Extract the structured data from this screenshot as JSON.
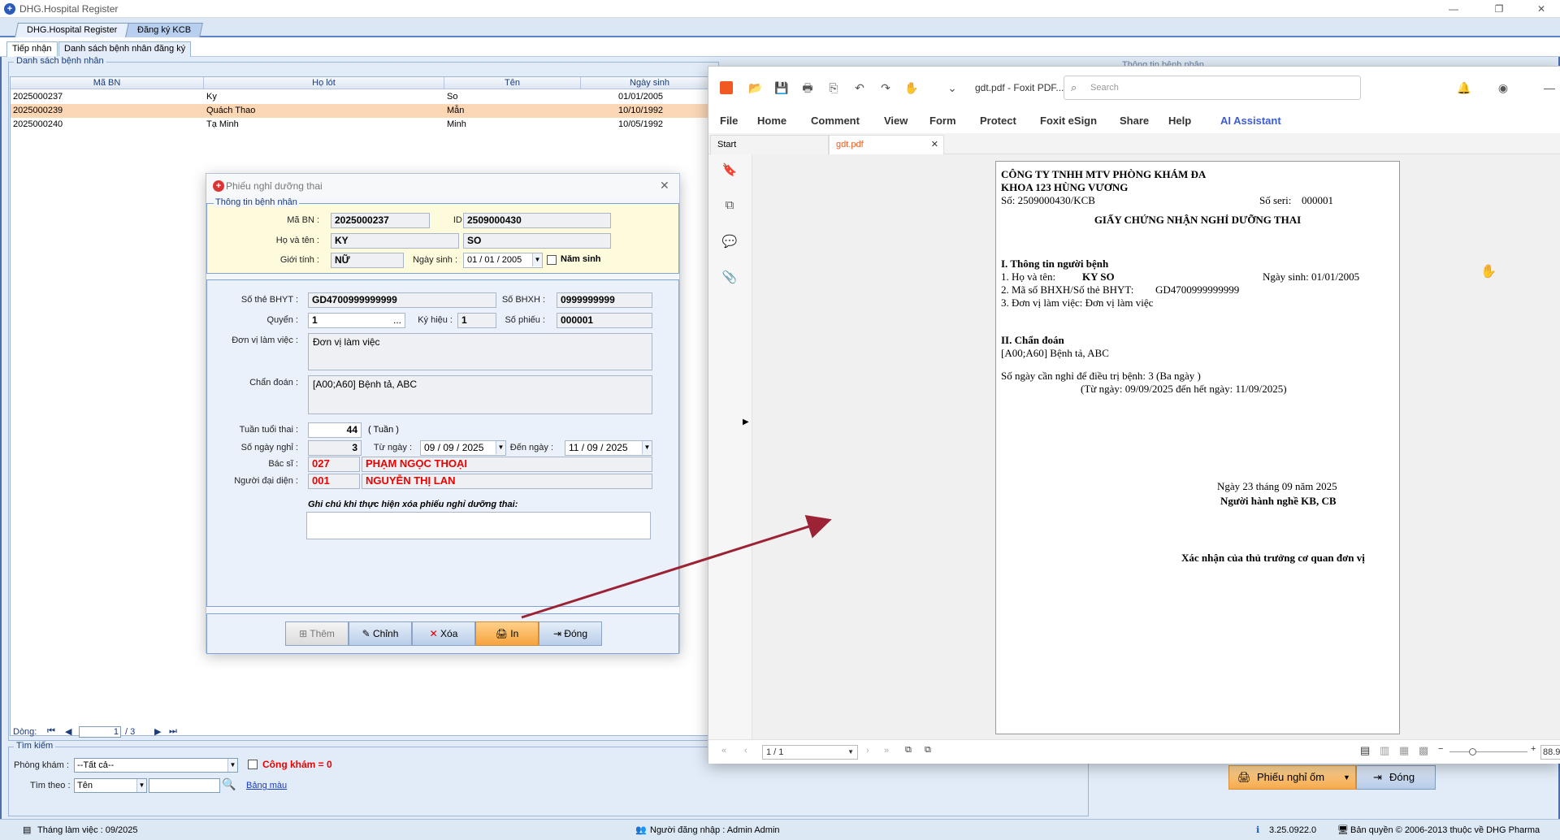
{
  "app": {
    "title": "DHG.Hospital Register",
    "main_tabs": [
      "DHG.Hospital Register",
      "Đăng ký KCB"
    ],
    "sub_tabs": [
      "Tiếp nhận",
      "Danh sách bệnh nhân đăng ký"
    ],
    "patient_group_title": "Danh sách bệnh nhân",
    "partial_group_title": "Thông tin bệnh nhân",
    "table_headers": [
      "Mã BN",
      "Họ lót",
      "Tên",
      "Ngày sinh"
    ],
    "rows": [
      {
        "ma_bn": "2025000237",
        "ho_lot": "Ky",
        "ten": "So",
        "ngay_sinh": "01/01/2005"
      },
      {
        "ma_bn": "2025000239",
        "ho_lot": "Quách Thao",
        "ten": "Mẫn",
        "ngay_sinh": "10/10/1992"
      },
      {
        "ma_bn": "2025000240",
        "ho_lot": "Tạ Minh",
        "ten": "Minh",
        "ngay_sinh": "10/05/1992"
      }
    ],
    "pager": {
      "label": "Dòng:",
      "current": "1",
      "total": "/ 3"
    },
    "search": {
      "group_title": "Tìm kiếm",
      "phong_kham_label": "Phòng khám :",
      "phong_kham_value": "--Tất cả--",
      "cong_kham_label": "Công khám = 0",
      "tim_theo_label": "Tìm theo :",
      "tim_theo_value": "Tên",
      "bang_mau": "Bảng màu"
    },
    "buttons": {
      "phieu_nghi_om": "Phiếu nghỉ ốm",
      "dong": "Đóng"
    },
    "status": {
      "thang_lam_viec": "Tháng làm việc : 09/2025",
      "nguoi_dang_nhap": "Người đăng nhập : Admin Admin",
      "version": "3.25.0922.0",
      "ban_quyen": "Bản quyền © 2006-2013 thuộc về DHG Pharma"
    }
  },
  "dialog": {
    "title": "Phiếu nghỉ dưỡng thai",
    "info_group_title": "Thông tin bệnh nhân",
    "ma_bn_label": "Mã BN :",
    "ma_bn": "2025000237",
    "id_label": "ID :",
    "id": "2509000430",
    "ho_ten_label": "Họ và tên :",
    "ho": "KY",
    "ten": "SO",
    "gioi_tinh_label": "Giới tính :",
    "gioi_tinh": "NỮ",
    "ngay_sinh_label": "Ngày sinh :",
    "ngay_sinh": "01 / 01 / 2005",
    "nam_sinh_label": "Năm sinh",
    "so_the_bhyt_label": "Số thẻ BHYT :",
    "so_the_bhyt": "GD4700999999999",
    "so_bhxh_label": "Số BHXH :",
    "so_bhxh": "0999999999",
    "quyen_label": "Quyển :",
    "quyen": "1",
    "ky_hieu_label": "Ký hiệu :",
    "ky_hieu": "1",
    "so_phieu_label": "Số phiếu :",
    "so_phieu": "000001",
    "don_vi_label": "Đơn vị làm việc :",
    "don_vi": "Đơn vị làm việc",
    "chan_doan_label": "Chẩn đoán :",
    "chan_doan": "[A00;A60] Bệnh tả, ABC",
    "tuan_tuoi_label": "Tuần tuổi thai :",
    "tuan_tuoi": "44",
    "tuan_unit": "( Tuần )",
    "so_ngay_label": "Số ngày nghỉ :",
    "so_ngay": "3",
    "tu_ngay_label": "Từ ngày :",
    "tu_ngay": "09 / 09 / 2025",
    "den_ngay_label": "Đến ngày :",
    "den_ngay": "11 / 09 / 2025",
    "bac_si_label": "Bác sĩ :",
    "bac_si_ma": "027",
    "bac_si_ten": "PHẠM NGỌC THOẠI",
    "nguoi_dai_dien_label": "Người đại diện :",
    "ndd_ma": "001",
    "ndd_ten": "NGUYỄN THỊ LAN",
    "ghi_chu_label": "Ghi chú khi thực hiện xóa phiếu nghỉ dưỡng thai:",
    "buttons": {
      "them": "Thêm",
      "chinh": "Chỉnh",
      "xoa": "Xóa",
      "in": "In",
      "dong": "Đóng"
    }
  },
  "foxit": {
    "doc_title": "gdt.pdf - Foxit PDF...",
    "search_placeholder": "Search",
    "menu": [
      "File",
      "Home",
      "Comment",
      "View",
      "Form",
      "Protect",
      "Foxit eSign",
      "Share",
      "Help",
      "AI Assistant"
    ],
    "tabs": [
      "Start",
      "gdt.pdf"
    ],
    "page_indicator": "1 / 1",
    "zoom": "88.9",
    "page": {
      "company1": "CÔNG TY TNHH MTV PHÒNG KHÁM ĐA",
      "company2": "KHOA 123 HÙNG VƯƠNG",
      "so": "Số: 2509000430/KCB",
      "so_seri_label": "Số seri:",
      "so_seri": "000001",
      "title": "GIẤY CHỨNG NHẬN NGHỈ DƯỠNG THAI",
      "section1": "I. Thông tin người bệnh",
      "ho_ten_label": "1. Họ và tên:",
      "ho_ten": "KY SO",
      "ngay_sinh": "Ngày sinh: 01/01/2005",
      "bhxh_label": "2. Mã số BHXH/Số thẻ BHYT:",
      "bhxh": "GD4700999999999",
      "don_vi": "3. Đơn vị làm việc:  Đơn vị làm việc",
      "section2": "II. Chẩn đoán",
      "chan_doan": "[A00;A60] Bệnh tả, ABC",
      "so_ngay": "Số ngày cần nghỉ để điều trị bệnh:  3 (Ba ngày )",
      "tu_den": "(Từ ngày: 09/09/2025 đến hết ngày: 11/09/2025)",
      "ngay_ky": "Ngày 23 tháng 09 năm 2025",
      "nguoi_hanh_nghe": "Người hành nghề KB, CB",
      "xac_nhan": "Xác nhận của thủ trưởng cơ quan đơn vị"
    }
  },
  "colors": {
    "accent_orange": "#f6a94c",
    "arrow": "#9b2335",
    "alert_red": "#e00000"
  }
}
